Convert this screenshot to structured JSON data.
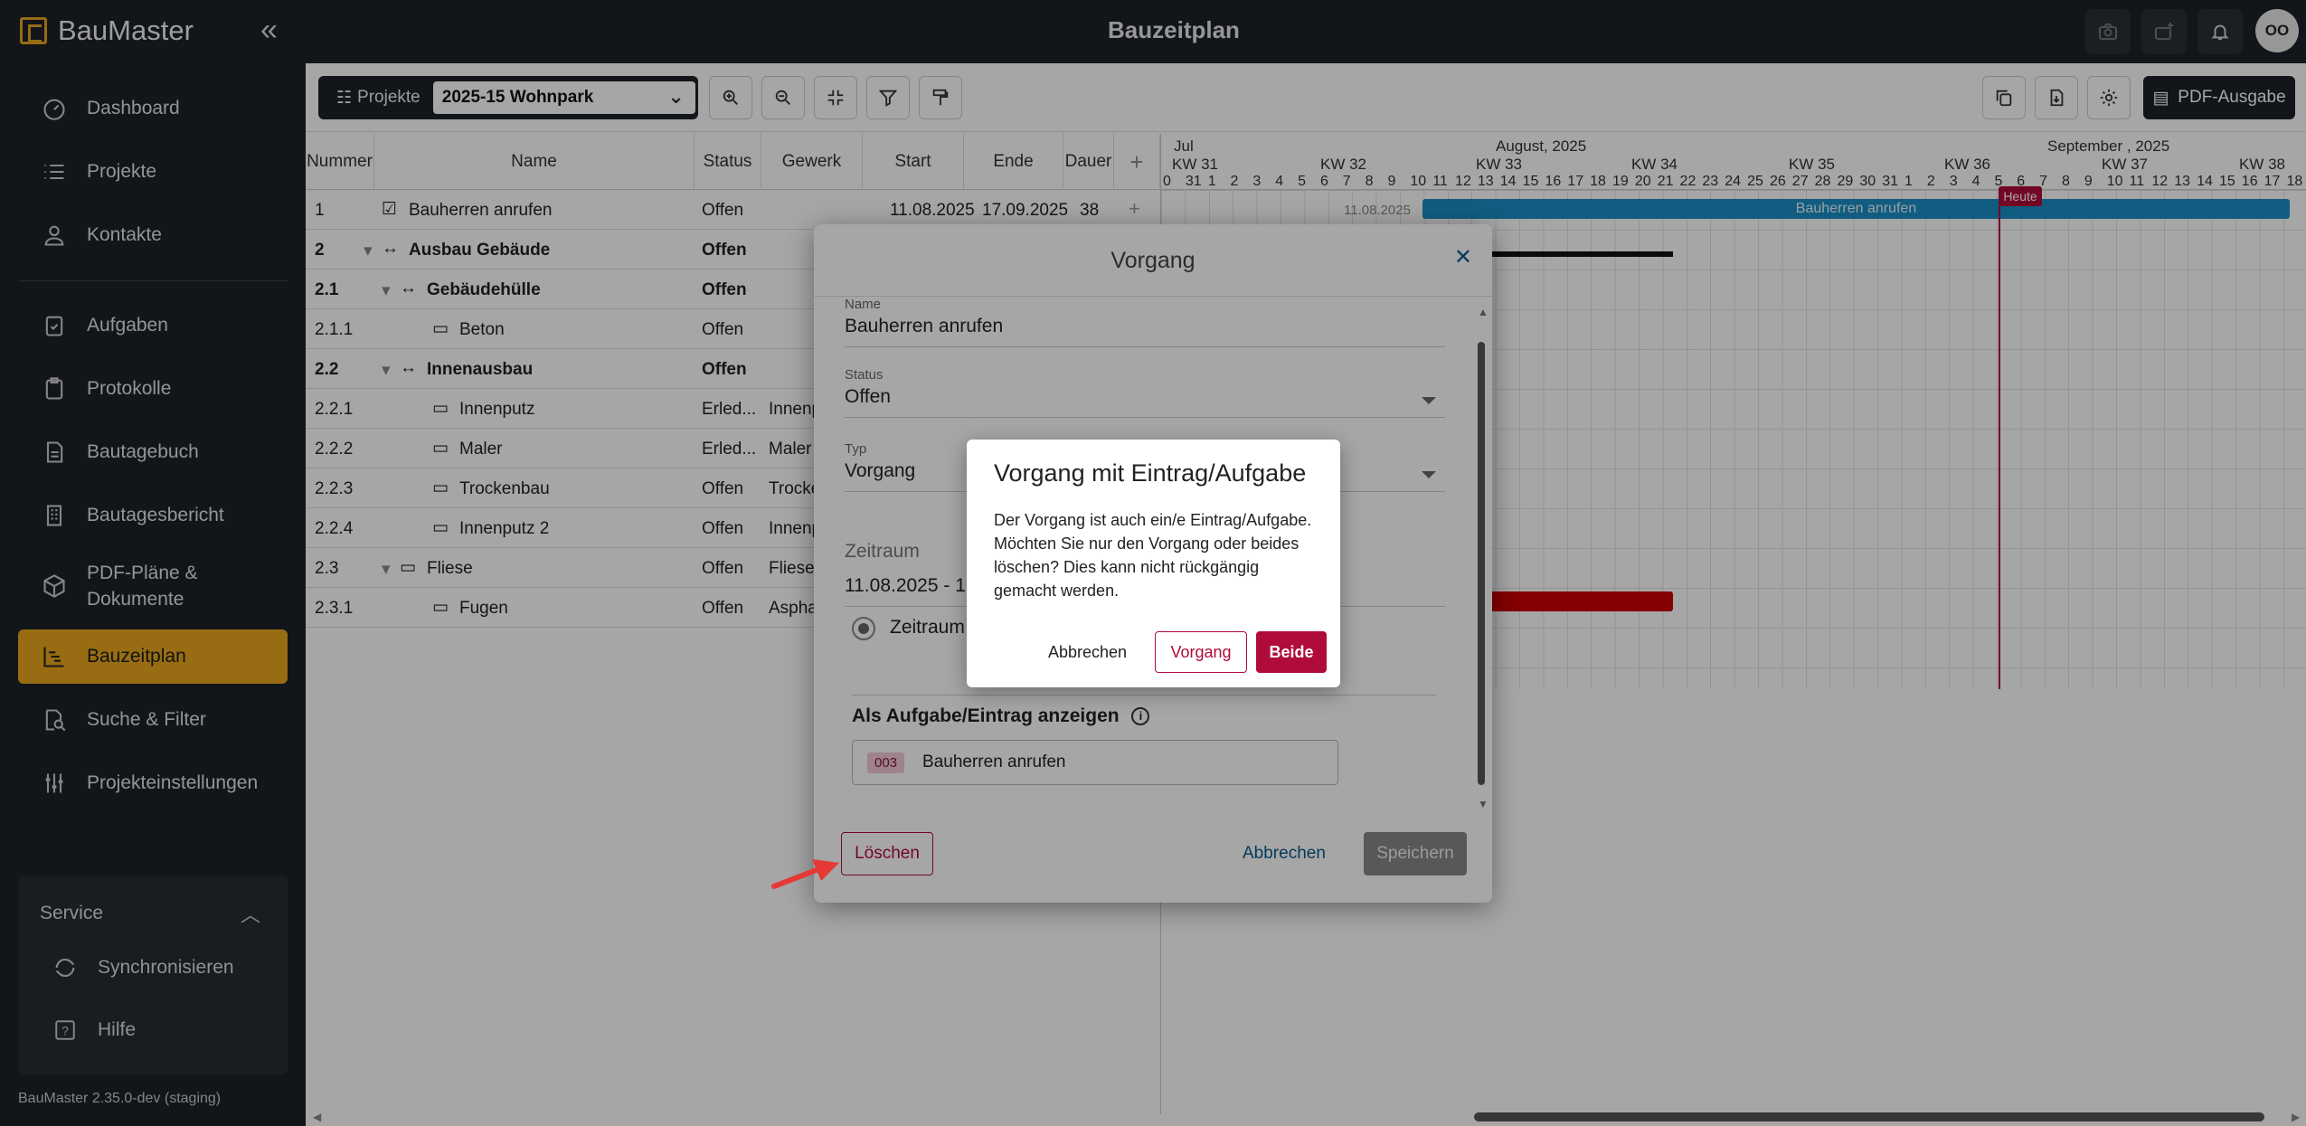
{
  "app": {
    "name": "BauMaster",
    "title": "Bauzeitplan",
    "avatar": "OO",
    "version": "BauMaster 2.35.0-dev (staging)"
  },
  "sidebar": {
    "items": [
      {
        "label": "Dashboard",
        "icon": "gauge-icon"
      },
      {
        "label": "Projekte",
        "icon": "list-icon"
      },
      {
        "label": "Kontakte",
        "icon": "person-icon"
      },
      {
        "label": "Aufgaben",
        "icon": "clipboard-check-icon"
      },
      {
        "label": "Protokolle",
        "icon": "clipboard-icon"
      },
      {
        "label": "Bautagebuch",
        "icon": "document-icon"
      },
      {
        "label": "Bautagesbericht",
        "icon": "building-icon"
      },
      {
        "label": "PDF-Pläne &",
        "label2": "Dokumente",
        "icon": "cube-icon"
      },
      {
        "label": "Bauzeitplan",
        "icon": "gantt-icon",
        "active": true
      },
      {
        "label": "Suche & Filter",
        "icon": "search-doc-icon"
      },
      {
        "label": "Projekteinstellungen",
        "icon": "sliders-icon"
      }
    ],
    "service": {
      "title": "Service",
      "items": [
        "Synchronisieren",
        "Hilfe"
      ]
    }
  },
  "toolbar": {
    "project_label": "Projekte",
    "project_value": "2025-15 Wohnpark",
    "pdf_label": "PDF-Ausgabe"
  },
  "grid": {
    "columns": [
      "Nummer",
      "Name",
      "Status",
      "Gewerk",
      "Start",
      "Ende",
      "Dauer"
    ],
    "rows": [
      {
        "num": "1",
        "name": "Bauherren anrufen",
        "status": "Offen",
        "gewerk": "",
        "start": "11.08.2025",
        "end": "17.09.2025",
        "dur": "38",
        "bold": false
      },
      {
        "num": "2",
        "name": "Ausbau Gebäude",
        "status": "Offen",
        "gewerk": "",
        "start": "",
        "end": "",
        "dur": "",
        "bold": true
      },
      {
        "num": "2.1",
        "name": "Gebäudehülle",
        "status": "Offen",
        "gewerk": "",
        "start": "",
        "end": "",
        "dur": "",
        "bold": true
      },
      {
        "num": "2.1.1",
        "name": "Beton",
        "status": "Offen",
        "gewerk": "",
        "start": "",
        "end": "",
        "dur": "",
        "bold": false
      },
      {
        "num": "2.2",
        "name": "Innenausbau",
        "status": "Offen",
        "gewerk": "",
        "start": "",
        "end": "",
        "dur": "",
        "bold": true
      },
      {
        "num": "2.2.1",
        "name": "Innenputz",
        "status": "Erled...",
        "gewerk": "Innenp",
        "start": "",
        "end": "",
        "dur": "",
        "bold": false
      },
      {
        "num": "2.2.2",
        "name": "Maler",
        "status": "Erled...",
        "gewerk": "Maler",
        "start": "",
        "end": "",
        "dur": "",
        "bold": false
      },
      {
        "num": "2.2.3",
        "name": "Trockenbau",
        "status": "Offen",
        "gewerk": "Trocke",
        "start": "",
        "end": "",
        "dur": "",
        "bold": false
      },
      {
        "num": "2.2.4",
        "name": "Innenputz 2",
        "status": "Offen",
        "gewerk": "Innenp",
        "start": "",
        "end": "",
        "dur": "",
        "bold": false
      },
      {
        "num": "2.3",
        "name": "Fliese",
        "status": "Offen",
        "gewerk": "Fliese",
        "start": "",
        "end": "",
        "dur": "",
        "bold": false
      },
      {
        "num": "2.3.1",
        "name": "Fugen",
        "status": "Offen",
        "gewerk": "Aspha",
        "start": "",
        "end": "",
        "dur": "",
        "bold": false
      }
    ]
  },
  "gantt": {
    "months": [
      "Jul",
      "August, 2025",
      "September , 2025"
    ],
    "weeks": [
      "KW 31",
      "KW 32",
      "KW 33",
      "KW 34",
      "KW 35",
      "KW 36",
      "KW 37",
      "KW 38"
    ],
    "days": [
      "0",
      "31",
      "1",
      "2",
      "3",
      "4",
      "5",
      "6",
      "7",
      "8",
      "9",
      "10",
      "11",
      "12",
      "13",
      "14",
      "15",
      "16",
      "17",
      "18",
      "19",
      "20",
      "21",
      "22",
      "23",
      "24",
      "25",
      "26",
      "27",
      "28",
      "29",
      "30",
      "31",
      "1",
      "2",
      "3",
      "4",
      "5",
      "6",
      "7",
      "8",
      "9",
      "10",
      "11",
      "12",
      "13",
      "14",
      "15",
      "16",
      "17",
      "18"
    ],
    "bar_label": "Bauherren anrufen",
    "bar_start_label": "11.08.2025",
    "today": "Heute"
  },
  "dialog": {
    "title": "Vorgang",
    "name_label": "Name",
    "name_value": "Bauherren anrufen",
    "status_label": "Status",
    "status_value": "Offen",
    "typ_label": "Typ",
    "typ_value": "Vorgang",
    "zeitraum_label": "Zeitraum",
    "zeitraum_value": "11.08.2025 - 17",
    "radio_label": "Zeitraum",
    "aufgabe_header": "Als Aufgabe/Eintrag anzeigen",
    "aufgabe_num": "003",
    "aufgabe_name": "Bauherren anrufen",
    "delete": "Löschen",
    "cancel": "Abbrechen",
    "save": "Speichern"
  },
  "confirm": {
    "title": "Vorgang mit Eintrag/Aufgabe",
    "body": "Der Vorgang ist auch ein/e Eintrag/Aufgabe. Möchten Sie nur den Vorgang oder beides löschen? Dies kann nicht rückgängig gemacht werden.",
    "cancel": "Abbrechen",
    "vorgang": "Vorgang",
    "beide": "Beide"
  }
}
